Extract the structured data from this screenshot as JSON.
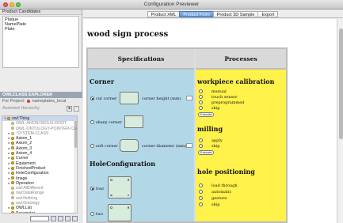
{
  "window": {
    "title": "Configuration Previewer"
  },
  "left": {
    "header": "Product Candidates",
    "candidates": [
      "Plaque",
      "NamePlate",
      "Plate"
    ],
    "explorer": {
      "title": "OWLCLASS EXPLORER",
      "project_label": "For Project:",
      "project_name": "nameplates_local",
      "asserted_label": "Asserted Hierarchy",
      "tree": [
        {
          "label": "owl:Thing",
          "expand": "▾",
          "indent": 0,
          "grey": false
        },
        {
          "label": "OWL-ANONYMOUS-ROOT",
          "expand": "",
          "indent": 1,
          "grey": true
        },
        {
          "label": "OWL-ONTOLOGY-POINTER-CLASS",
          "expand": "",
          "indent": 1,
          "grey": true
        },
        {
          "label": ":SYSTEM-CLASS",
          "expand": "▸",
          "indent": 1,
          "grey": true
        },
        {
          "label": "Axiom_1",
          "expand": "▸",
          "indent": 1,
          "grey": false
        },
        {
          "label": "Axiom_2",
          "expand": "▸",
          "indent": 1,
          "grey": false
        },
        {
          "label": "Axiom_3",
          "expand": "▸",
          "indent": 1,
          "grey": false
        },
        {
          "label": "Axiom_4",
          "expand": "▸",
          "indent": 1,
          "grey": false
        },
        {
          "label": "Corner",
          "expand": "▸",
          "indent": 1,
          "grey": false
        },
        {
          "label": "Equipment",
          "expand": "▸",
          "indent": 1,
          "grey": false
        },
        {
          "label": "FinishedProduct",
          "expand": "▸",
          "indent": 1,
          "grey": false
        },
        {
          "label": "HoleConfiguration",
          "expand": "▸",
          "indent": 1,
          "grey": false
        },
        {
          "label": "Image",
          "expand": "▸",
          "indent": 1,
          "grey": false
        },
        {
          "label": "Operation",
          "expand": "▸",
          "indent": 1,
          "grey": false
        },
        {
          "label": "owl:AllDifferent",
          "expand": "",
          "indent": 1,
          "grey": true
        },
        {
          "label": "owl:DataRange",
          "expand": "",
          "indent": 1,
          "grey": true
        },
        {
          "label": "owl:Nothing",
          "expand": "",
          "indent": 1,
          "grey": true
        },
        {
          "label": "owl:Ontology",
          "expand": "",
          "indent": 1,
          "grey": true
        },
        {
          "label": "OWLList",
          "expand": "▸",
          "indent": 1,
          "grey": false
        },
        {
          "label": "Parameter",
          "expand": "▸",
          "indent": 1,
          "grey": false
        }
      ]
    }
  },
  "tabs": [
    {
      "label": "Product XML",
      "active": false
    },
    {
      "label": "Product Form",
      "active": true
    },
    {
      "label": "Product 3D Sample",
      "active": false
    },
    {
      "label": "Export",
      "active": false
    }
  ],
  "form": {
    "title": "wood sign process",
    "spec_header": "Specifications",
    "proc_header": "Processes",
    "corner": {
      "title": "Corner",
      "options": [
        "cut corner",
        "sharp corner",
        "soft corner"
      ],
      "selected": 0,
      "height_label": "corner height (mm)",
      "diameter_label": "corner diameter (mm)"
    },
    "hole": {
      "title": "HoleConfiguration",
      "options": [
        "four",
        "two"
      ],
      "selected": 0
    },
    "calibration": {
      "title": "workpiece calibration",
      "options": [
        "manual",
        "touch sensor",
        "preprogrammed",
        "skip"
      ],
      "execute": "Execute"
    },
    "milling": {
      "title": "milling",
      "options": [
        "apply",
        "skip"
      ],
      "execute": "Execute"
    },
    "positioning": {
      "title": "hole positioning",
      "options": [
        "load through",
        "automatic",
        "gesture",
        "skip"
      ]
    }
  }
}
